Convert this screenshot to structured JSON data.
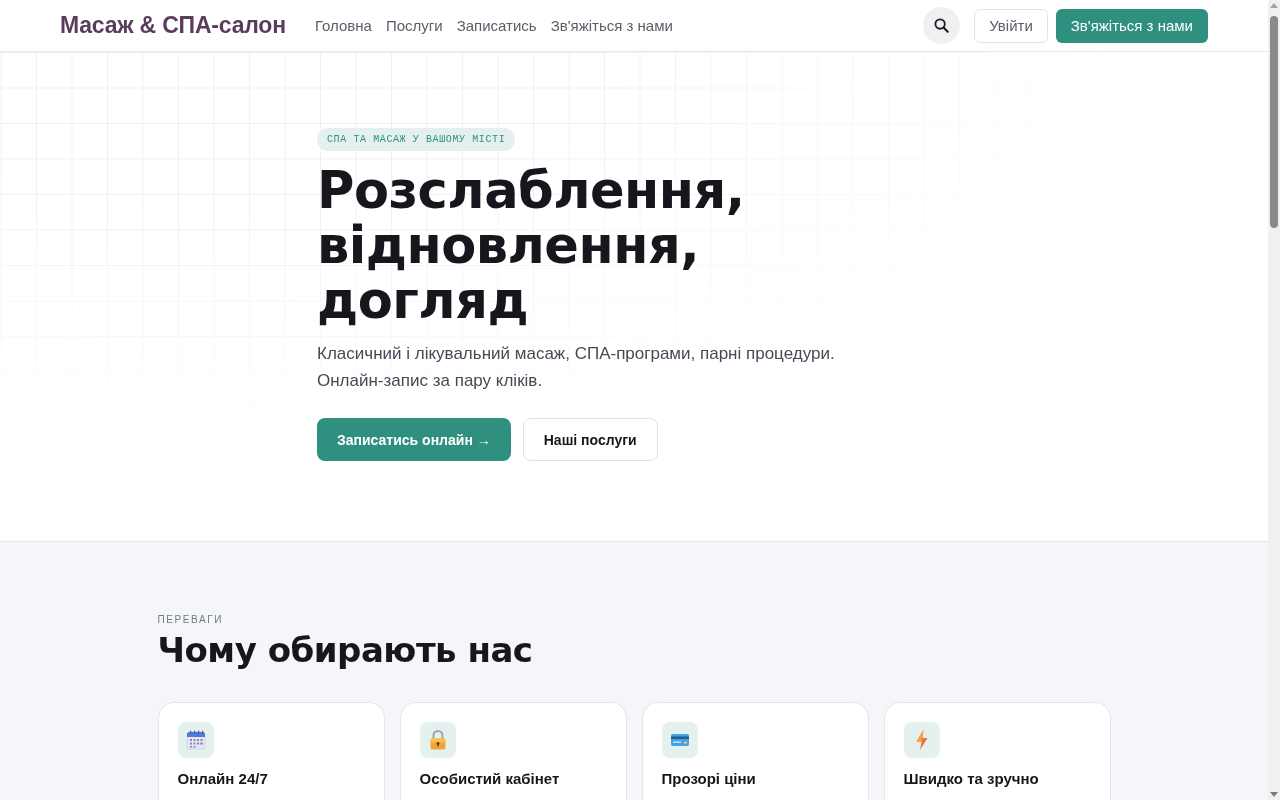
{
  "header": {
    "logo": "Масаж & СПА-салон",
    "nav": [
      "Головна",
      "Послуги",
      "Записатись",
      "Зв'яжіться з нами"
    ],
    "login_button": "Увійти",
    "contact_button": "Зв'яжіться з нами"
  },
  "hero": {
    "badge": "СПА ТА МАСАЖ У ВАШОМУ МІСТІ",
    "title": "Розслаблення, відновлення, догляд",
    "subtitle": "Класичний і лікувальний масаж, СПА-програми, парні процедури. Онлайн-запис за пару кліків.",
    "buttons": [
      {
        "label": "Записатись онлайн →",
        "kind": "primary"
      },
      {
        "label": "Наші послуги",
        "kind": "secondary"
      }
    ]
  },
  "features": {
    "eyebrow": "ПЕРЕВАГИ",
    "title": "Чому обирають нас",
    "cards": [
      {
        "title": "Онлайн 24/7",
        "kind": "calendar"
      },
      {
        "title": "Особистий кабінет",
        "kind": "lock"
      },
      {
        "title": "Прозорі ціни",
        "kind": "card"
      },
      {
        "title": "Швидко та зручно",
        "kind": "bolt"
      }
    ]
  }
}
